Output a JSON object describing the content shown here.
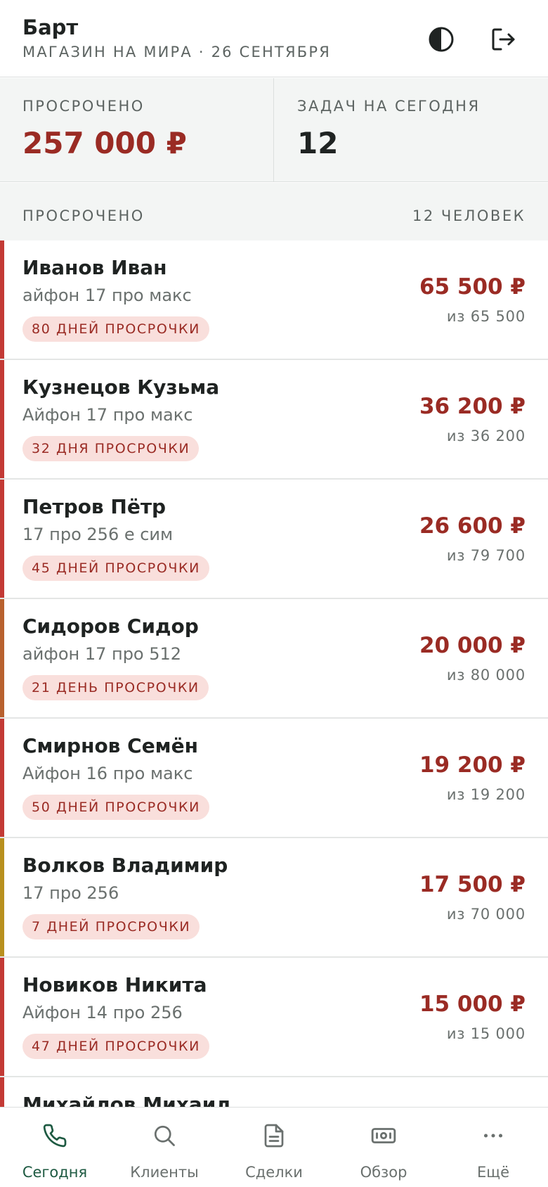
{
  "header": {
    "title": "Барт",
    "subtitle": "МАГАЗИН НА МИРА · 26 СЕНТЯБРЯ",
    "theme_icon": "contrast-icon",
    "logout_icon": "logout-icon"
  },
  "stats": {
    "overdue": {
      "label": "ПРОСРОЧЕНО",
      "value": "257 000 ₽"
    },
    "tasks": {
      "label": "ЗАДАЧ НА СЕГОДНЯ",
      "value": "12"
    }
  },
  "section": {
    "title": "ПРОСРОЧЕНО",
    "count": "12 ЧЕЛОВЕК"
  },
  "colors": {
    "accent_red": "#9a2b24",
    "badge_bg": "#f9dfdc",
    "nav_active": "#1e5a42",
    "bar_red": "#c33a35",
    "bar_orange": "#b8612e",
    "bar_yellow": "#b8901e"
  },
  "clients": [
    {
      "name": "Иванов Иван",
      "device": "айфон 17 про макс",
      "badge": "80 ДНЕЙ ПРОСРОЧКИ",
      "amount": "65 500 ₽",
      "total": "из 65 500",
      "bar_color": "#c33a35"
    },
    {
      "name": "Кузнецов Кузьма",
      "device": "Айфон 17 про макс",
      "badge": "32 ДНЯ ПРОСРОЧКИ",
      "amount": "36 200 ₽",
      "total": "из 36 200",
      "bar_color": "#c33a35"
    },
    {
      "name": "Петров Пётр",
      "device": "17 про 256 е сим",
      "badge": "45 ДНЕЙ ПРОСРОЧКИ",
      "amount": "26 600 ₽",
      "total": "из 79 700",
      "bar_color": "#c33a35"
    },
    {
      "name": "Сидоров Сидор",
      "device": "айфон 17 про 512",
      "badge": "21 ДЕНЬ ПРОСРОЧКИ",
      "amount": "20 000 ₽",
      "total": "из 80 000",
      "bar_color": "#b8612e"
    },
    {
      "name": "Смирнов Семён",
      "device": "Айфон 16 про макс",
      "badge": "50 ДНЕЙ ПРОСРОЧКИ",
      "amount": "19 200 ₽",
      "total": "из 19 200",
      "bar_color": "#c33a35"
    },
    {
      "name": "Волков Владимир",
      "device": "17 про 256",
      "badge": "7 ДНЕЙ ПРОСРОЧКИ",
      "amount": "17 500 ₽",
      "total": "из 70 000",
      "bar_color": "#b8901e"
    },
    {
      "name": "Новиков Никита",
      "device": "Айфон 14 про 256",
      "badge": "47 ДНЕЙ ПРОСРОЧКИ",
      "amount": "15 000 ₽",
      "total": "из 15 000",
      "bar_color": "#c33a35"
    },
    {
      "name": "Михайлов Михаил",
      "device": "",
      "badge": "",
      "amount": "",
      "total": "",
      "bar_color": "#c33a35"
    }
  ],
  "nav": [
    {
      "label": "Сегодня",
      "icon": "phone-icon",
      "active": true
    },
    {
      "label": "Клиенты",
      "icon": "search-icon",
      "active": false
    },
    {
      "label": "Сделки",
      "icon": "document-icon",
      "active": false
    },
    {
      "label": "Обзор",
      "icon": "banknote-icon",
      "active": false
    },
    {
      "label": "Ещё",
      "icon": "more-icon",
      "active": false
    }
  ]
}
